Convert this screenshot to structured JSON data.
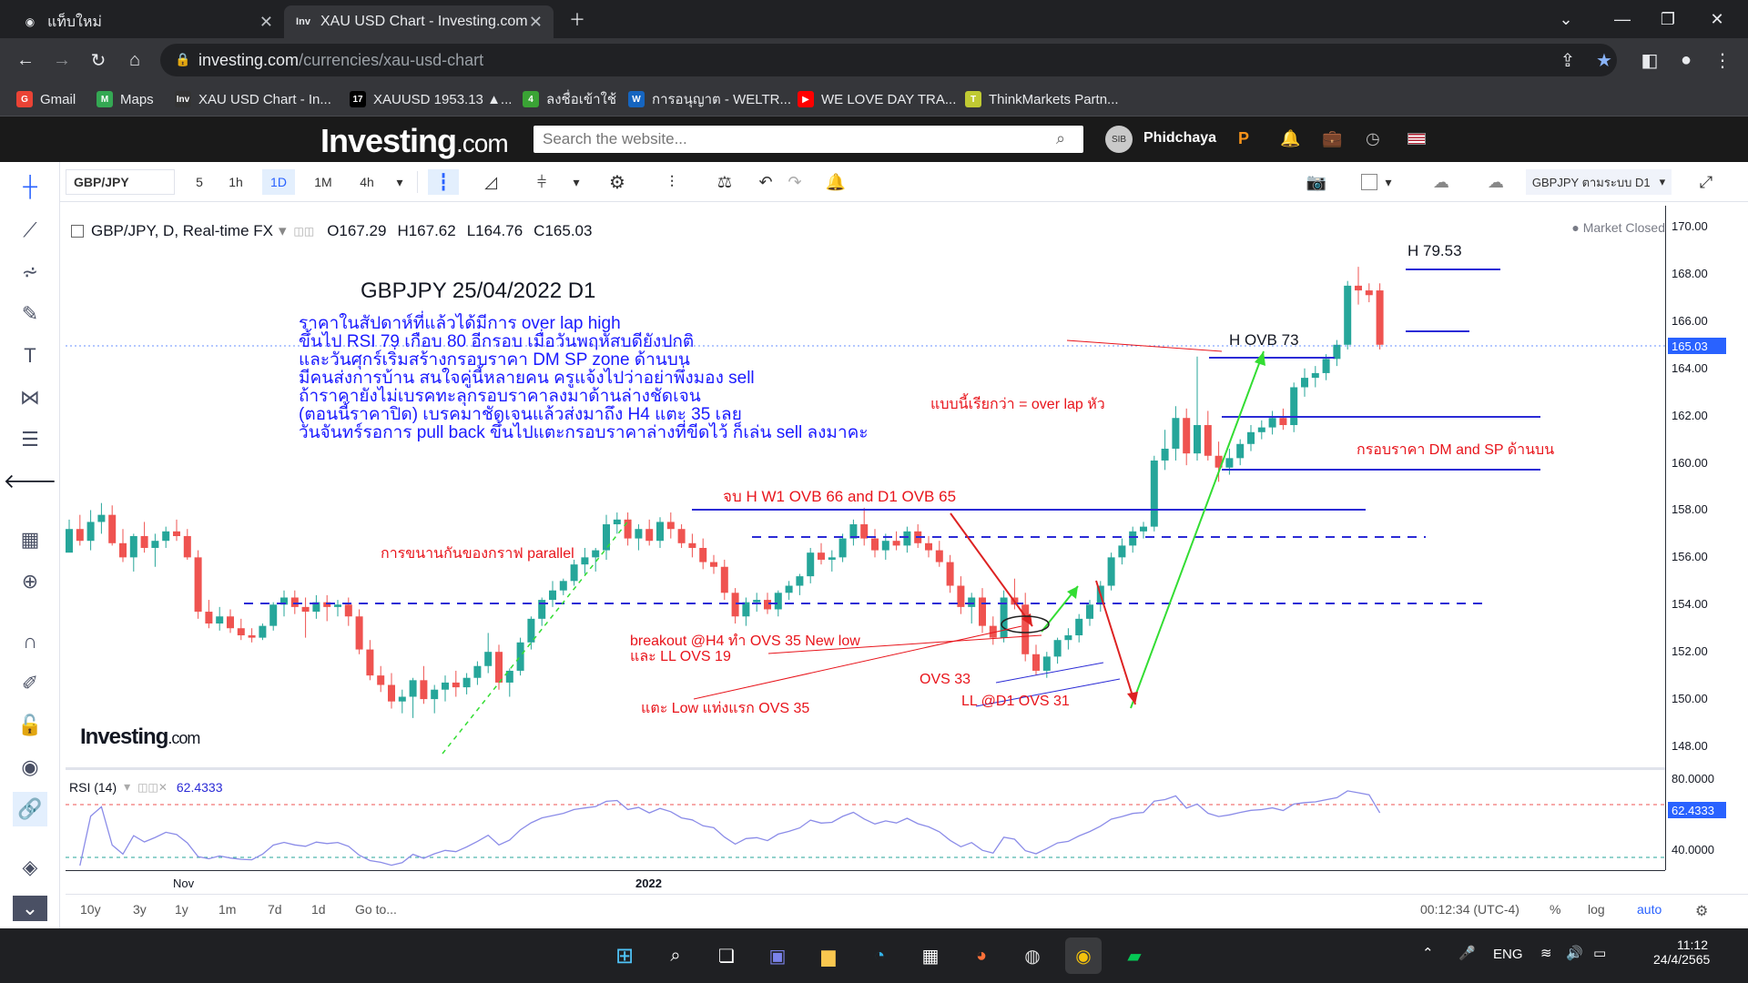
{
  "browser": {
    "tabs": [
      {
        "title": "แท็บใหม่",
        "active": false
      },
      {
        "title": "XAU USD Chart - Investing.com",
        "active": true
      }
    ],
    "url_host": "investing.com",
    "url_path": "/currencies/xau-usd-chart",
    "bookmarks": [
      {
        "label": "Gmail",
        "icon": "gmail-icon",
        "color": "#ea4335"
      },
      {
        "label": "Maps",
        "icon": "maps-icon",
        "color": "#34a853"
      },
      {
        "label": "XAU USD Chart - In...",
        "icon": "investing-icon",
        "color": "#333333"
      },
      {
        "label": "XAUUSD 1953.13 ▲...",
        "icon": "tradingview-icon",
        "color": "#000000"
      },
      {
        "label": "ลงชื่อเข้าใช้",
        "icon": "green-app-icon",
        "color": "#3aa335"
      },
      {
        "label": "การอนุญาต - WELTR...",
        "icon": "weltrade-icon",
        "color": "#1565c0"
      },
      {
        "label": "WE LOVE DAY TRA...",
        "icon": "youtube-icon",
        "color": "#ff0000"
      },
      {
        "label": "ThinkMarkets Partn...",
        "icon": "thinkmarkets-icon",
        "color": "#c0ca33"
      }
    ]
  },
  "site": {
    "logo_text": "Investing",
    "logo_suffix": ".com",
    "search_placeholder": "Search the website...",
    "username": "Phidchaya",
    "avatar_text": "SIB"
  },
  "toolbar": {
    "symbol": "GBP/JPY",
    "intervals": [
      "5",
      "1h",
      "1D",
      "1M",
      "4h"
    ],
    "selected_interval": "1D",
    "layout_label": "GBPJPY ตามระบบ D1"
  },
  "legend": {
    "title": "GBP/JPY, D, Real-time FX",
    "open": "O167.29",
    "high": "H167.62",
    "low": "L164.76",
    "close": "C165.03",
    "market_status": "Market Closed",
    "rsi_label": "RSI (14)",
    "rsi_value": "62.4333"
  },
  "annotations": {
    "title": "GBPJPY 25/04/2022 D1",
    "notes": [
      "ราคาในสัปดาห์ที่แล้วได้มีการ over lap high",
      "ขึ้นไป RSI 79 เกือบ 80 อีกรอบ เมื่อวันพฤหัสบดียังปกติ",
      "และวันศุกร์เริ่มสร้างกรอบราคา DM SP zone ด้านบน",
      "มีคนส่งการบ้าน สนใจคู่นี้หลายคน ครูแจ้งไปว่าอย่าพึ่งมอง sell",
      "ถ้าราคายังไม่เบรคทะลุกรอบราคาลงมาด้านล่างชัดเจน",
      "(ตอนนี้ราคาปิด) เบรคมาชัดเจนแล้วส่งมาถึง H4 แตะ 35 เลย",
      "วันจันทร์รอการ pull back ขึ้นไปแตะกรอบราคาล่างที่ขีดไว้ ก็เล่น sell ลงมาคะ"
    ],
    "h_79": "H 79.53",
    "h_ovb73": "H OVB 73",
    "overlap": "แบบนี้เรียกว่า = over lap หัว",
    "zone": "กรอบราคา DM and SP ด้านบน",
    "w1": "จบ H W1 OVB 66 and D1 OVB 65",
    "parallel": "การขนานกันของกราฟ parallel",
    "breakout1": "breakout @H4 ทำ OVS 35 New low",
    "breakout2": "และ LL OVS 19",
    "ovs33": "OVS 33",
    "ll31": "LL @D1 OVS 31",
    "touch": "แตะ Low แท่งแรก OVS 35",
    "watermark": "Investing",
    "watermark_suffix": ".com"
  },
  "price_axis": {
    "ticks": [
      "170.00",
      "168.00",
      "166.00",
      "164.00",
      "162.00",
      "160.00",
      "158.00",
      "156.00",
      "154.00",
      "152.00",
      "150.00",
      "148.00"
    ],
    "last_price": "165.03",
    "rsi_ticks": [
      "80.0000",
      "40.0000"
    ],
    "rsi_last": "62.4333"
  },
  "time_axis": {
    "labels": [
      "Nov",
      "2022"
    ]
  },
  "bottom": {
    "ranges": [
      "10y",
      "3y",
      "1y",
      "1m",
      "7d",
      "1d"
    ],
    "goto": "Go to...",
    "clock": "00:12:34 (UTC-4)",
    "pct": "%",
    "log": "log",
    "auto": "auto"
  },
  "taskbar": {
    "lang": "ENG",
    "time": "11:12",
    "date": "24/4/2565"
  },
  "colors": {
    "up": "#26a69a",
    "down": "#ef5350",
    "annotation_blue": "#1a1aff",
    "annotation_red": "#e8141b",
    "level_line": "#2b2bd6",
    "accent": "#2962ff"
  },
  "chart_data": {
    "type": "candlestick",
    "ylim": [
      148,
      170
    ],
    "candles": [
      [
        156.2,
        157.6,
        156.6,
        157.2
      ],
      [
        157.2,
        157.8,
        156.5,
        156.7
      ],
      [
        156.7,
        158.0,
        156.3,
        157.5
      ],
      [
        157.5,
        158.3,
        157.0,
        157.8
      ],
      [
        157.8,
        158.2,
        156.5,
        156.6
      ],
      [
        156.6,
        157.2,
        155.8,
        156.0
      ],
      [
        156.0,
        157.0,
        155.4,
        156.9
      ],
      [
        156.9,
        157.5,
        156.2,
        156.4
      ],
      [
        156.4,
        157.0,
        155.6,
        156.7
      ],
      [
        156.7,
        157.3,
        156.4,
        157.1
      ],
      [
        157.1,
        157.6,
        156.7,
        156.9
      ],
      [
        156.9,
        157.2,
        155.9,
        156.0
      ],
      [
        156.0,
        156.3,
        153.4,
        153.7
      ],
      [
        153.7,
        154.2,
        153.0,
        153.2
      ],
      [
        153.2,
        153.9,
        152.9,
        153.5
      ],
      [
        153.5,
        153.8,
        152.8,
        153.0
      ],
      [
        153.0,
        153.4,
        152.5,
        152.7
      ],
      [
        152.7,
        153.0,
        152.4,
        152.6
      ],
      [
        152.6,
        153.2,
        152.5,
        153.1
      ],
      [
        153.1,
        154.1,
        152.9,
        154.0
      ],
      [
        154.0,
        154.6,
        153.5,
        154.3
      ],
      [
        154.3,
        154.6,
        153.6,
        153.9
      ],
      [
        153.9,
        154.3,
        152.6,
        153.7
      ],
      [
        153.7,
        154.4,
        153.4,
        154.1
      ],
      [
        154.1,
        154.4,
        153.3,
        153.9
      ],
      [
        153.9,
        154.2,
        153.5,
        154.0
      ],
      [
        154.0,
        154.3,
        153.1,
        153.5
      ],
      [
        153.5,
        153.8,
        151.9,
        152.1
      ],
      [
        152.1,
        152.5,
        150.8,
        151.0
      ],
      [
        151.0,
        151.4,
        150.3,
        150.6
      ],
      [
        150.6,
        151.1,
        149.6,
        149.9
      ],
      [
        149.9,
        150.4,
        149.4,
        150.1
      ],
      [
        150.1,
        150.9,
        149.2,
        150.8
      ],
      [
        150.8,
        151.4,
        149.8,
        150.0
      ],
      [
        150.0,
        150.6,
        149.4,
        150.4
      ],
      [
        150.4,
        151.0,
        149.9,
        150.7
      ],
      [
        150.7,
        151.2,
        150.1,
        150.5
      ],
      [
        150.5,
        151.1,
        150.2,
        150.9
      ],
      [
        150.9,
        151.6,
        150.6,
        151.4
      ],
      [
        151.4,
        152.8,
        151.1,
        152.0
      ],
      [
        152.0,
        152.3,
        150.4,
        150.7
      ],
      [
        150.7,
        151.3,
        150.1,
        151.2
      ],
      [
        151.2,
        152.6,
        151.0,
        152.4
      ],
      [
        152.4,
        153.5,
        152.1,
        153.4
      ],
      [
        153.4,
        154.3,
        153.1,
        154.2
      ],
      [
        154.2,
        155.0,
        153.9,
        154.6
      ],
      [
        154.6,
        155.1,
        154.4,
        155.0
      ],
      [
        155.0,
        155.9,
        154.8,
        155.7
      ],
      [
        155.7,
        156.4,
        155.3,
        156.0
      ],
      [
        156.0,
        156.4,
        155.4,
        156.3
      ],
      [
        156.3,
        157.8,
        155.9,
        157.4
      ],
      [
        157.4,
        157.9,
        157.0,
        157.6
      ],
      [
        157.6,
        157.9,
        156.5,
        156.8
      ],
      [
        156.8,
        157.4,
        156.3,
        157.2
      ],
      [
        157.2,
        157.6,
        156.5,
        156.7
      ],
      [
        156.7,
        157.7,
        156.4,
        157.5
      ],
      [
        157.5,
        157.9,
        156.8,
        157.2
      ],
      [
        157.2,
        157.4,
        156.4,
        156.6
      ],
      [
        156.6,
        157.0,
        156.0,
        156.4
      ],
      [
        156.4,
        156.8,
        155.5,
        155.8
      ],
      [
        155.8,
        156.1,
        155.3,
        155.6
      ],
      [
        155.6,
        155.9,
        154.2,
        154.5
      ],
      [
        154.5,
        154.7,
        153.2,
        153.5
      ],
      [
        153.5,
        154.3,
        153.1,
        154.1
      ],
      [
        154.1,
        154.5,
        153.7,
        154.2
      ],
      [
        154.2,
        154.5,
        153.6,
        153.8
      ],
      [
        153.8,
        154.6,
        153.5,
        154.5
      ],
      [
        154.5,
        155.0,
        154.2,
        154.8
      ],
      [
        154.8,
        155.3,
        154.4,
        155.2
      ],
      [
        155.2,
        156.4,
        154.9,
        156.2
      ],
      [
        156.2,
        156.6,
        155.7,
        155.9
      ],
      [
        155.9,
        156.3,
        155.4,
        156.0
      ],
      [
        156.0,
        157.0,
        155.8,
        156.8
      ],
      [
        156.8,
        157.6,
        156.5,
        157.4
      ],
      [
        157.4,
        158.1,
        156.5,
        156.8
      ],
      [
        156.8,
        157.2,
        156.0,
        156.3
      ],
      [
        156.3,
        157.0,
        155.9,
        156.7
      ],
      [
        156.7,
        157.1,
        156.3,
        156.5
      ],
      [
        156.5,
        157.3,
        156.2,
        157.1
      ],
      [
        157.1,
        157.4,
        156.4,
        156.6
      ],
      [
        156.6,
        156.9,
        156.0,
        156.3
      ],
      [
        156.3,
        156.7,
        155.6,
        155.8
      ],
      [
        155.8,
        156.1,
        154.5,
        154.8
      ],
      [
        154.8,
        155.2,
        153.6,
        153.9
      ],
      [
        153.9,
        154.5,
        153.2,
        154.3
      ],
      [
        154.3,
        154.7,
        152.8,
        153.1
      ],
      [
        153.1,
        153.5,
        152.3,
        152.6
      ],
      [
        152.6,
        154.6,
        152.4,
        154.3
      ],
      [
        154.3,
        155.1,
        153.8,
        154.0
      ],
      [
        154.0,
        154.5,
        151.6,
        151.9
      ],
      [
        151.9,
        152.3,
        151.0,
        151.2
      ],
      [
        151.2,
        152.0,
        150.9,
        151.8
      ],
      [
        151.8,
        152.6,
        151.5,
        152.5
      ],
      [
        152.5,
        153.0,
        152.1,
        152.7
      ],
      [
        152.7,
        153.6,
        152.4,
        153.4
      ],
      [
        153.4,
        154.2,
        153.1,
        154.0
      ],
      [
        154.0,
        155.0,
        153.7,
        154.8
      ],
      [
        154.8,
        156.2,
        154.6,
        156.0
      ],
      [
        156.0,
        156.8,
        155.7,
        156.5
      ],
      [
        156.5,
        157.3,
        156.2,
        157.1
      ],
      [
        157.1,
        157.5,
        156.8,
        157.3
      ],
      [
        157.3,
        160.3,
        157.1,
        160.1
      ],
      [
        160.1,
        161.4,
        159.7,
        160.6
      ],
      [
        160.6,
        162.4,
        160.1,
        161.9
      ],
      [
        161.9,
        162.3,
        159.9,
        160.4
      ],
      [
        160.4,
        164.5,
        160.1,
        161.6
      ],
      [
        161.6,
        162.2,
        160.1,
        160.3
      ],
      [
        160.3,
        160.9,
        159.2,
        159.8
      ],
      [
        159.8,
        160.6,
        159.5,
        160.2
      ],
      [
        160.2,
        161.0,
        159.9,
        160.8
      ],
      [
        160.8,
        161.6,
        160.5,
        161.3
      ],
      [
        161.3,
        161.8,
        161.0,
        161.5
      ],
      [
        161.5,
        162.2,
        161.2,
        161.9
      ],
      [
        161.9,
        162.3,
        161.4,
        161.6
      ],
      [
        161.6,
        163.4,
        161.3,
        163.2
      ],
      [
        163.2,
        164.0,
        162.8,
        163.6
      ],
      [
        163.6,
        164.1,
        163.2,
        163.8
      ],
      [
        163.8,
        164.6,
        163.5,
        164.4
      ],
      [
        164.4,
        165.2,
        164.1,
        165.0
      ],
      [
        165.0,
        167.7,
        164.8,
        167.5
      ],
      [
        167.5,
        168.3,
        166.7,
        167.3
      ],
      [
        167.3,
        167.6,
        166.8,
        167.1
      ],
      [
        167.3,
        167.6,
        164.8,
        165.0
      ]
    ],
    "rsi": {
      "upper": 80,
      "lower": 40,
      "last": 62.4333
    }
  }
}
